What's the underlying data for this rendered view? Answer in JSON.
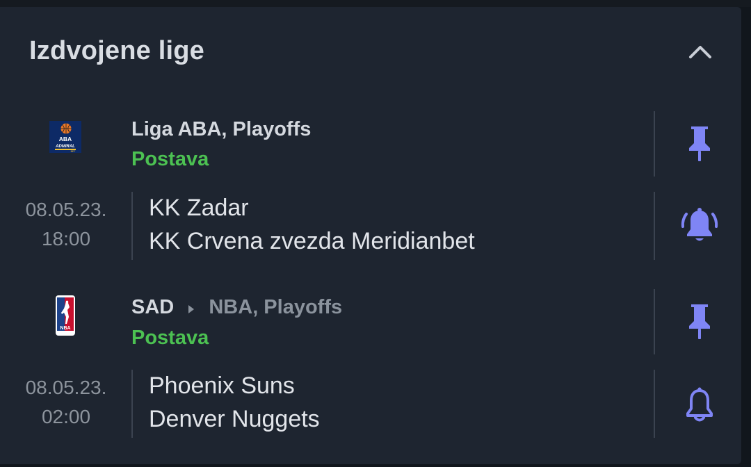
{
  "section": {
    "title": "Izdvojene lige"
  },
  "leagues": [
    {
      "name": "Liga ABA, Playoffs",
      "lineup_label": "Postava",
      "logo": "aba-league-logo",
      "logo_text": "ABA ADMIRAL BET",
      "pin_icon": "pin-icon",
      "match": {
        "date": "08.05.23.",
        "time": "18:00",
        "home": "KK Zadar",
        "away": "KK Crvena zvezda Meridianbet",
        "alert_icon": "bell-ringing-icon"
      }
    },
    {
      "country": "SAD",
      "name": "NBA, Playoffs",
      "lineup_label": "Postava",
      "logo": "nba-logo",
      "logo_text": "NBA",
      "pin_icon": "pin-icon",
      "match": {
        "date": "08.05.23.",
        "time": "02:00",
        "home": "Phoenix Suns",
        "away": "Denver Nuggets",
        "alert_icon": "bell-icon"
      }
    }
  ],
  "colors": {
    "accent": "#7f85f5",
    "lineup": "#4cc152",
    "background": "#1e2530",
    "divider": "#3b4350"
  }
}
